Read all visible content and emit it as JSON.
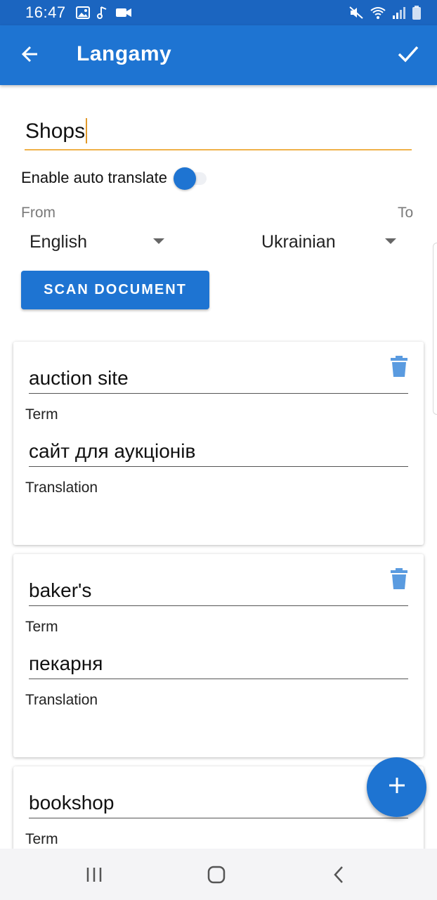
{
  "status_bar": {
    "time": "16:47",
    "left_icons": [
      "image-icon",
      "music-note-icon",
      "video-camera-icon"
    ],
    "right_icons": [
      "mute-icon",
      "wifi-icon",
      "signal-icon",
      "battery-icon"
    ]
  },
  "app_bar": {
    "title": "Langamy",
    "back_icon": "arrow-back-icon",
    "confirm_icon": "check-icon"
  },
  "form": {
    "name_value": "Shops",
    "auto_translate_label": "Enable auto translate",
    "auto_translate_enabled": false,
    "from_label": "From",
    "to_label": "To",
    "from_language": "English",
    "to_language": "Ukrainian",
    "scan_button": "SCAN DOCUMENT"
  },
  "cards": [
    {
      "term": "auction site",
      "term_label": "Term",
      "translation": "сайт для аукціонів",
      "translation_label": "Translation"
    },
    {
      "term": "baker's",
      "term_label": "Term",
      "translation": "пекарня",
      "translation_label": "Translation"
    },
    {
      "term": "bookshop",
      "term_label": "Term"
    }
  ],
  "fab": {
    "icon": "plus-icon"
  },
  "nav_bar": {
    "buttons": [
      "recent-apps-icon",
      "home-icon",
      "back-icon"
    ]
  },
  "colors": {
    "primary": "#1e74d2",
    "status_bar": "#1b65c0",
    "input_focus": "#f0b24a",
    "trash": "#5a9be0"
  }
}
